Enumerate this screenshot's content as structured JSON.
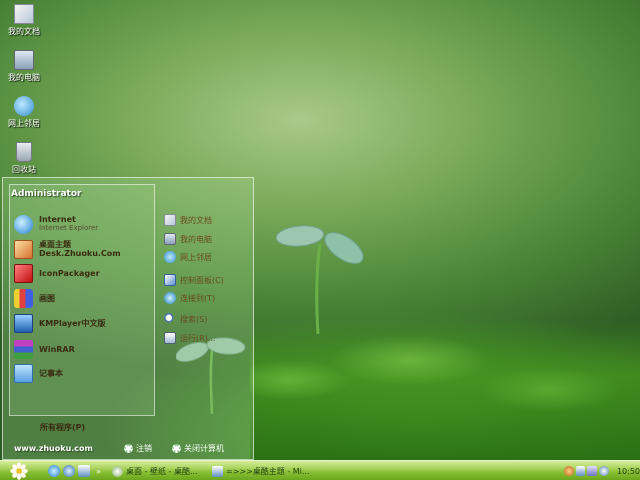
{
  "desktop": {
    "icons": [
      {
        "label": "我的文档"
      },
      {
        "label": "我的电脑"
      },
      {
        "label": "网上邻居"
      },
      {
        "label": "回收站"
      }
    ]
  },
  "startmenu": {
    "username": "Administrator",
    "programs": [
      {
        "title": "Internet",
        "subtitle": "Internet Explorer"
      },
      {
        "title": "桌面主题Desk.Zhuoku.Com",
        "subtitle": ""
      },
      {
        "title": "IconPackager",
        "subtitle": ""
      },
      {
        "title": "画图",
        "subtitle": ""
      },
      {
        "title": "KMPlayer中文版",
        "subtitle": ""
      },
      {
        "title": "WinRAR",
        "subtitle": ""
      },
      {
        "title": "记事本",
        "subtitle": ""
      }
    ],
    "all_programs": "所有程序(P)",
    "right_links": [
      {
        "label": "我的文档"
      },
      {
        "label": "我的电脑"
      },
      {
        "label": "网上邻居"
      },
      {
        "label": "控制面板(C)"
      },
      {
        "label": "连接到(T)"
      },
      {
        "label": "搜索(S)"
      },
      {
        "label": "运行(R)..."
      }
    ],
    "website": "www.zhuoku.com",
    "logoff": "注销",
    "shutdown": "关闭计算机"
  },
  "taskbar": {
    "items": [
      {
        "label": "桌面 - 壁纸 - 桌酷..."
      },
      {
        "label": "=>>>桌酷主题 - Mi..."
      }
    ],
    "clock": "10:50"
  },
  "colors": {
    "taskbar": "#86bf33",
    "accent": "#6aa61d"
  }
}
